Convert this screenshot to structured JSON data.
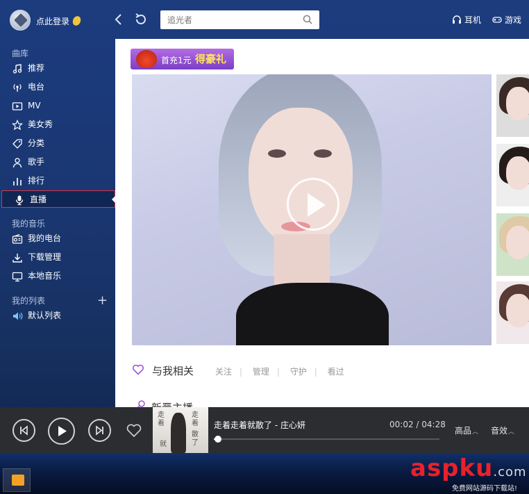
{
  "header": {
    "login_label": "点此登录",
    "search_placeholder": "追光者",
    "earphones_label": "耳机",
    "games_label": "游戏"
  },
  "sidebar": {
    "library_title": "曲库",
    "library_items": [
      {
        "label": "推荐",
        "icon": "music-note-icon"
      },
      {
        "label": "电台",
        "icon": "radio-icon"
      },
      {
        "label": "MV",
        "icon": "mv-icon"
      },
      {
        "label": "美女秀",
        "icon": "star-icon"
      },
      {
        "label": "分类",
        "icon": "tag-icon"
      },
      {
        "label": "歌手",
        "icon": "person-icon"
      },
      {
        "label": "排行",
        "icon": "chart-icon"
      },
      {
        "label": "直播",
        "icon": "microphone-icon",
        "active": true
      }
    ],
    "my_music_title": "我的音乐",
    "my_music_items": [
      {
        "label": "我的电台",
        "icon": "radio-box-icon"
      },
      {
        "label": "下载管理",
        "icon": "download-icon"
      },
      {
        "label": "本地音乐",
        "icon": "monitor-icon"
      }
    ],
    "my_lists_title": "我的列表",
    "my_lists_items": [
      {
        "label": "默认列表",
        "icon": "speaker-icon"
      }
    ]
  },
  "main": {
    "promo_text": "首充1元",
    "promo_highlight": "得豪礼",
    "related_title": "与我相关",
    "related_links": [
      "关注",
      "管理",
      "守护",
      "看过"
    ],
    "new_anchor_title": "新晋主播"
  },
  "player": {
    "song_title": "走着走着就散了 - 庄心妍",
    "current_time": "00:02",
    "total_time": "04:28",
    "progress": 0.01,
    "quality_label": "高品",
    "effect_label": "音效",
    "cover_text": [
      "走着",
      "就",
      "走着",
      "散了"
    ]
  },
  "watermark": {
    "brand_a": "asp",
    "brand_b": "ku",
    "brand_dom": ".com",
    "tagline": "免费网站源码下载站!"
  },
  "colors": {
    "sidebar_bg": "#1a3670",
    "active_border": "#d9374b",
    "player_bg": "#2b2d30",
    "promo_purple": "#9b55d6"
  }
}
